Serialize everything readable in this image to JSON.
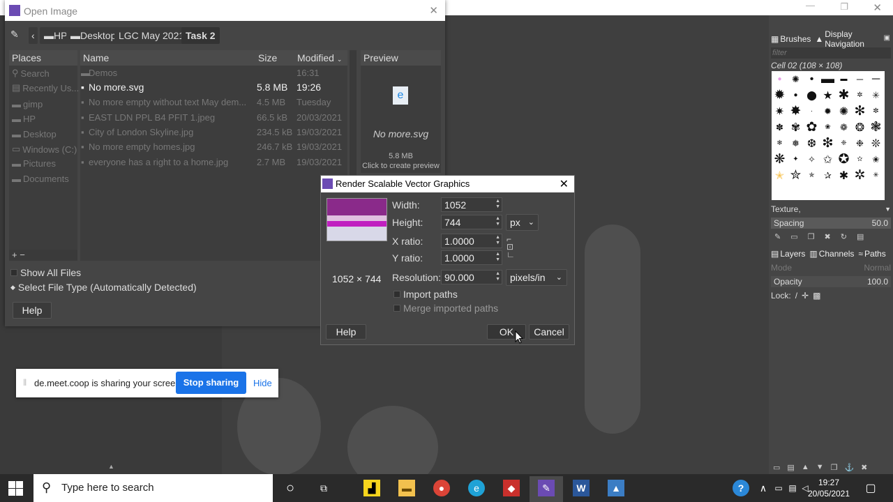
{
  "open_dialog": {
    "title": "Open Image",
    "path": [
      "HP",
      "Desktop",
      "LGC May 2021",
      "Task 2"
    ],
    "columns": {
      "places": "Places",
      "name": "Name",
      "size": "Size",
      "modified": "Modified"
    },
    "places": [
      "Search",
      "Recently Us...",
      "gimp",
      "HP",
      "Desktop",
      "Windows (C:)",
      "Pictures",
      "Documents"
    ],
    "files": [
      {
        "name": "Demos",
        "size": "",
        "modified": "16:31"
      },
      {
        "name": "No more.svg",
        "size": "5.8 MB",
        "modified": "19:26"
      },
      {
        "name": "No more empty without text May dem...",
        "size": "4.5 MB",
        "modified": "Tuesday"
      },
      {
        "name": "EAST LDN PPL B4 PFIT 1.jpeg",
        "size": "66.5 kB",
        "modified": "20/03/2021"
      },
      {
        "name": "City of London Skyline.jpg",
        "size": "234.5 kB",
        "modified": "19/03/2021"
      },
      {
        "name": "No more empty homes.jpg",
        "size": "246.7 kB",
        "modified": "19/03/2021"
      },
      {
        "name": "everyone has a right to a home.jpg",
        "size": "2.7 MB",
        "modified": "19/03/2021"
      }
    ],
    "preview": {
      "heading": "Preview",
      "filename": "No more.svg",
      "size": "5.8 MB",
      "hint": "Click to create preview"
    },
    "places_controls": "+ −",
    "show_all_files": "Show All Files",
    "file_type": "Select File Type (Automatically Detected)",
    "help_label": "Help"
  },
  "svg_dialog": {
    "title": "Render Scalable Vector Graphics",
    "width_label": "Width:",
    "width_value": "1052",
    "height_label": "Height:",
    "height_value": "744",
    "unit": "px",
    "x_ratio_label": "X ratio:",
    "x_ratio_value": "1.0000",
    "y_ratio_label": "Y ratio:",
    "y_ratio_value": "1.0000",
    "resolution_label": "Resolution:",
    "resolution_value": "90.000",
    "resolution_unit": "pixels/in",
    "dimensions": "1052 × 744",
    "import_paths": "Import paths",
    "merge_paths": "Merge imported paths",
    "help_label": "Help",
    "ok_label": "OK",
    "cancel_label": "Cancel"
  },
  "dock": {
    "tab_brushes": "Brushes",
    "tab_navigation": "Display Navigation",
    "filter_placeholder": "filter",
    "brush_name": "Cell 02 (108 × 108)",
    "category": "Texture,",
    "spacing_label": "Spacing",
    "spacing_value": "50.0",
    "tab_layers": "Layers",
    "tab_channels": "Channels",
    "tab_paths": "Paths",
    "mode_label": "Mode",
    "mode_value": "Normal",
    "opacity_label": "Opacity",
    "opacity_value": "100.0",
    "lock_label": "Lock:"
  },
  "share_bar": {
    "message": "de.meet.coop is sharing your screen.",
    "stop_label": "Stop sharing",
    "hide_label": "Hide"
  },
  "taskbar": {
    "search_placeholder": "Type here to search",
    "time": "19:27",
    "date": "20/05/2021"
  },
  "colors": {
    "accent": "#1a73e8",
    "dialog_bg": "#454545",
    "taskbar": "#2a2a2a"
  }
}
